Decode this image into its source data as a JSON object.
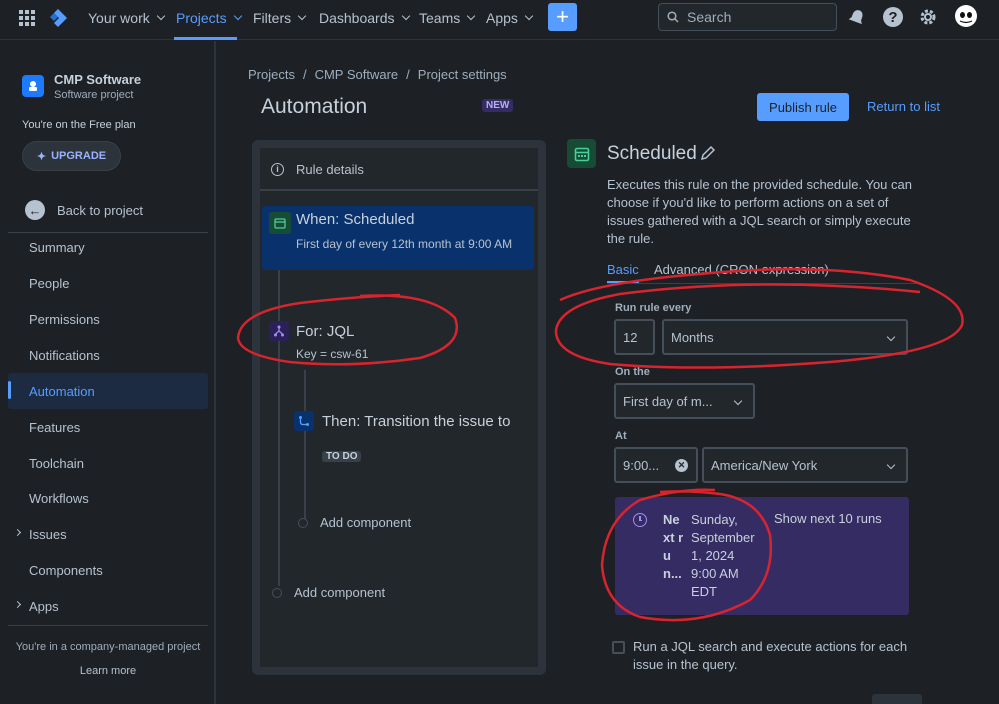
{
  "topnav": {
    "your_work": "Your work",
    "projects": "Projects",
    "filters": "Filters",
    "dashboards": "Dashboards",
    "teams": "Teams",
    "apps": "Apps",
    "create": "+",
    "search_placeholder": "Search"
  },
  "sidebar": {
    "project_name": "CMP Software",
    "project_type": "Software project",
    "plan_text": "You're on the Free plan",
    "upgrade": "UPGRADE",
    "back": "Back to project",
    "items": [
      {
        "label": "Summary"
      },
      {
        "label": "People"
      },
      {
        "label": "Permissions"
      },
      {
        "label": "Notifications"
      },
      {
        "label": "Automation"
      },
      {
        "label": "Features"
      },
      {
        "label": "Toolchain"
      },
      {
        "label": "Workflows"
      },
      {
        "label": "Issues"
      },
      {
        "label": "Components"
      },
      {
        "label": "Apps"
      }
    ],
    "footer_text": "You're in a company-managed project",
    "learn_more": "Learn more"
  },
  "breadcrumb": {
    "items": [
      "Projects",
      "CMP Software",
      "Project settings"
    ],
    "sep": "/"
  },
  "page": {
    "title": "Automation",
    "badge": "NEW",
    "publish": "Publish rule",
    "return": "Return to list"
  },
  "rule": {
    "details": "Rule details",
    "trigger_title": "When: Scheduled",
    "trigger_desc": "First day of every 12th month at 9:00 AM",
    "branch_title": "For: JQL",
    "branch_desc": "Key = csw-61",
    "action_title": "Then: Transition the issue to",
    "action_status": "TO DO",
    "add_component_inner": "Add component",
    "add_component_outer": "Add component"
  },
  "panel": {
    "title": "Scheduled",
    "description": "Executes this rule on the provided schedule. You can choose if you'd like to perform actions on a set of issues gathered with a JQL search or simply execute the rule.",
    "tabs": [
      "Basic",
      "Advanced (CRON expression)"
    ],
    "run_every_label": "Run rule every",
    "run_every_value": "12",
    "period": "Months",
    "on_the_label": "On the",
    "on_the_value": "First day of m...",
    "at_label": "At",
    "time_value": "9:00...",
    "timezone": "America/New York",
    "next_run_label": "Next run...",
    "next_run_value": "Sunday, September 1, 2024 9:00 AM EDT",
    "show_next": "Show next 10 runs",
    "jql_checkbox": "Run a JQL search and execute actions for each issue in the query."
  },
  "colors": {
    "accent": "#579dff",
    "annotation": "#d8242f",
    "next_run_bg": "#352c63"
  }
}
